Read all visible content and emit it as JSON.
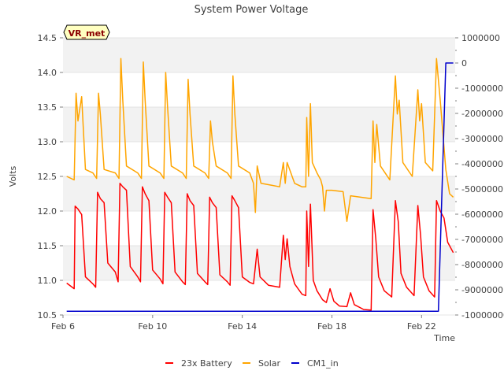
{
  "chart_data": {
    "type": "line",
    "title": "System Power Voltage",
    "xlabel": "Time",
    "ylabel": "Volts",
    "badge": "VR_met",
    "x_axis": {
      "type": "date",
      "start": "2024-02-06T00:00",
      "end": "2024-02-23T12:00",
      "ticks": [
        "Feb 6",
        "Feb 10",
        "Feb 14",
        "Feb 18",
        "Feb 22"
      ],
      "tick_dates": [
        "2024-02-06",
        "2024-02-10",
        "2024-02-14",
        "2024-02-18",
        "2024-02-22"
      ]
    },
    "y_axis_left": {
      "range": [
        10.5,
        14.5
      ],
      "ticks": [
        "10.5",
        "11.0",
        "11.5",
        "12.0",
        "12.5",
        "13.0",
        "13.5",
        "14.0",
        "14.5"
      ],
      "grid": true,
      "bands": "alternating gray"
    },
    "y_axis_right": {
      "range": [
        -10000000,
        1000000
      ],
      "ticks": [
        "-10000000",
        "-9000000",
        "-8000000",
        "-7000000",
        "-6000000",
        "-5000000",
        "-4000000",
        "-3000000",
        "-2000000",
        "-1000000",
        "0",
        "1000000"
      ]
    },
    "legend": {
      "placement": "bottom-center",
      "entries": [
        "23x Battery",
        "Solar",
        "CM1_in"
      ]
    },
    "series": [
      {
        "name": "23x Battery",
        "axis": "left",
        "color": "#ff0000",
        "points": [
          [
            "2024-02-06T04:00",
            10.96
          ],
          [
            "2024-02-06T12:00",
            10.88
          ],
          [
            "2024-02-06T13:00",
            12.07
          ],
          [
            "2024-02-06T16:00",
            12.03
          ],
          [
            "2024-02-06T20:00",
            11.95
          ],
          [
            "2024-02-07T00:00",
            11.05
          ],
          [
            "2024-02-07T08:00",
            10.95
          ],
          [
            "2024-02-07T11:00",
            10.9
          ],
          [
            "2024-02-07T13:00",
            12.27
          ],
          [
            "2024-02-07T16:00",
            12.18
          ],
          [
            "2024-02-07T20:00",
            12.12
          ],
          [
            "2024-02-08T00:00",
            11.25
          ],
          [
            "2024-02-08T08:00",
            11.12
          ],
          [
            "2024-02-08T11:00",
            10.98
          ],
          [
            "2024-02-08T13:00",
            12.4
          ],
          [
            "2024-02-08T16:00",
            12.35
          ],
          [
            "2024-02-08T20:00",
            12.3
          ],
          [
            "2024-02-09T00:00",
            11.2
          ],
          [
            "2024-02-09T08:00",
            11.05
          ],
          [
            "2024-02-09T11:00",
            10.98
          ],
          [
            "2024-02-09T13:00",
            12.35
          ],
          [
            "2024-02-09T16:00",
            12.25
          ],
          [
            "2024-02-09T20:00",
            12.15
          ],
          [
            "2024-02-10T00:00",
            11.15
          ],
          [
            "2024-02-10T08:00",
            11.02
          ],
          [
            "2024-02-10T11:00",
            10.95
          ],
          [
            "2024-02-10T13:00",
            12.27
          ],
          [
            "2024-02-10T16:00",
            12.2
          ],
          [
            "2024-02-10T20:00",
            12.12
          ],
          [
            "2024-02-11T00:00",
            11.12
          ],
          [
            "2024-02-11T08:00",
            10.98
          ],
          [
            "2024-02-11T11:00",
            10.94
          ],
          [
            "2024-02-11T13:00",
            12.25
          ],
          [
            "2024-02-11T16:00",
            12.15
          ],
          [
            "2024-02-11T20:00",
            12.08
          ],
          [
            "2024-02-12T00:00",
            11.1
          ],
          [
            "2024-02-12T08:00",
            10.98
          ],
          [
            "2024-02-12T11:00",
            10.94
          ],
          [
            "2024-02-12T13:00",
            12.2
          ],
          [
            "2024-02-12T16:00",
            12.12
          ],
          [
            "2024-02-12T20:00",
            12.05
          ],
          [
            "2024-02-13T00:00",
            11.08
          ],
          [
            "2024-02-13T08:00",
            10.98
          ],
          [
            "2024-02-13T11:00",
            10.93
          ],
          [
            "2024-02-13T13:00",
            12.22
          ],
          [
            "2024-02-13T16:00",
            12.15
          ],
          [
            "2024-02-13T20:00",
            12.05
          ],
          [
            "2024-02-14T00:00",
            11.05
          ],
          [
            "2024-02-14T08:00",
            10.97
          ],
          [
            "2024-02-14T12:00",
            10.95
          ],
          [
            "2024-02-14T14:00",
            11.2
          ],
          [
            "2024-02-14T16:00",
            11.45
          ],
          [
            "2024-02-14T19:00",
            11.05
          ],
          [
            "2024-02-15T04:00",
            10.93
          ],
          [
            "2024-02-15T16:00",
            10.9
          ],
          [
            "2024-02-15T20:00",
            11.65
          ],
          [
            "2024-02-15T22:00",
            11.3
          ],
          [
            "2024-02-16T00:00",
            11.6
          ],
          [
            "2024-02-16T03:00",
            11.2
          ],
          [
            "2024-02-16T08:00",
            10.95
          ],
          [
            "2024-02-16T16:00",
            10.8
          ],
          [
            "2024-02-16T20:00",
            10.78
          ],
          [
            "2024-02-16T21:00",
            12.0
          ],
          [
            "2024-02-16T23:00",
            11.2
          ],
          [
            "2024-02-17T01:00",
            12.1
          ],
          [
            "2024-02-17T04:00",
            11.0
          ],
          [
            "2024-02-17T08:00",
            10.85
          ],
          [
            "2024-02-17T14:00",
            10.72
          ],
          [
            "2024-02-17T18:00",
            10.68
          ],
          [
            "2024-02-17T22:00",
            10.88
          ],
          [
            "2024-02-18T02:00",
            10.7
          ],
          [
            "2024-02-18T08:00",
            10.63
          ],
          [
            "2024-02-18T16:00",
            10.62
          ],
          [
            "2024-02-18T20:00",
            10.82
          ],
          [
            "2024-02-19T00:00",
            10.65
          ],
          [
            "2024-02-19T10:00",
            10.58
          ],
          [
            "2024-02-19T18:00",
            10.57
          ],
          [
            "2024-02-19T20:00",
            12.02
          ],
          [
            "2024-02-19T23:00",
            11.6
          ],
          [
            "2024-02-20T02:00",
            11.05
          ],
          [
            "2024-02-20T08:00",
            10.85
          ],
          [
            "2024-02-20T16:00",
            10.76
          ],
          [
            "2024-02-20T20:00",
            12.15
          ],
          [
            "2024-02-20T23:00",
            11.85
          ],
          [
            "2024-02-21T02:00",
            11.1
          ],
          [
            "2024-02-21T08:00",
            10.9
          ],
          [
            "2024-02-21T16:00",
            10.78
          ],
          [
            "2024-02-21T20:00",
            12.08
          ],
          [
            "2024-02-21T23:00",
            11.65
          ],
          [
            "2024-02-22T02:00",
            11.05
          ],
          [
            "2024-02-22T08:00",
            10.85
          ],
          [
            "2024-02-22T14:00",
            10.76
          ],
          [
            "2024-02-22T16:00",
            12.15
          ],
          [
            "2024-02-22T20:00",
            12.0
          ],
          [
            "2024-02-23T00:00",
            11.9
          ],
          [
            "2024-02-23T04:00",
            11.55
          ],
          [
            "2024-02-23T10:00",
            11.4
          ]
        ]
      },
      {
        "name": "Solar",
        "axis": "left",
        "color": "#ffa500",
        "points": [
          [
            "2024-02-06T04:00",
            12.5
          ],
          [
            "2024-02-06T12:00",
            12.45
          ],
          [
            "2024-02-06T14:00",
            13.7
          ],
          [
            "2024-02-06T16:00",
            13.3
          ],
          [
            "2024-02-06T20:00",
            13.65
          ],
          [
            "2024-02-07T00:00",
            12.6
          ],
          [
            "2024-02-07T08:00",
            12.55
          ],
          [
            "2024-02-07T12:00",
            12.47
          ],
          [
            "2024-02-07T14:00",
            13.7
          ],
          [
            "2024-02-07T16:00",
            13.4
          ],
          [
            "2024-02-07T20:00",
            12.6
          ],
          [
            "2024-02-08T08:00",
            12.55
          ],
          [
            "2024-02-08T12:00",
            12.47
          ],
          [
            "2024-02-08T14:00",
            14.2
          ],
          [
            "2024-02-08T16:00",
            13.6
          ],
          [
            "2024-02-08T20:00",
            12.65
          ],
          [
            "2024-02-09T08:00",
            12.55
          ],
          [
            "2024-02-09T12:00",
            12.47
          ],
          [
            "2024-02-09T14:00",
            14.15
          ],
          [
            "2024-02-09T16:00",
            13.6
          ],
          [
            "2024-02-09T20:00",
            12.65
          ],
          [
            "2024-02-10T08:00",
            12.55
          ],
          [
            "2024-02-10T12:00",
            12.47
          ],
          [
            "2024-02-10T14:00",
            14.0
          ],
          [
            "2024-02-10T16:00",
            13.5
          ],
          [
            "2024-02-10T20:00",
            12.65
          ],
          [
            "2024-02-11T08:00",
            12.55
          ],
          [
            "2024-02-11T12:00",
            12.47
          ],
          [
            "2024-02-11T14:00",
            13.9
          ],
          [
            "2024-02-11T16:00",
            13.4
          ],
          [
            "2024-02-11T20:00",
            12.65
          ],
          [
            "2024-02-12T08:00",
            12.55
          ],
          [
            "2024-02-12T12:00",
            12.47
          ],
          [
            "2024-02-12T14:00",
            13.3
          ],
          [
            "2024-02-12T16:00",
            13.0
          ],
          [
            "2024-02-12T20:00",
            12.65
          ],
          [
            "2024-02-13T08:00",
            12.55
          ],
          [
            "2024-02-13T12:00",
            12.47
          ],
          [
            "2024-02-13T14:00",
            13.95
          ],
          [
            "2024-02-13T16:00",
            13.4
          ],
          [
            "2024-02-13T20:00",
            12.65
          ],
          [
            "2024-02-14T08:00",
            12.55
          ],
          [
            "2024-02-14T12:00",
            12.4
          ],
          [
            "2024-02-14T14:00",
            11.98
          ],
          [
            "2024-02-14T16:00",
            12.65
          ],
          [
            "2024-02-14T20:00",
            12.4
          ],
          [
            "2024-02-15T08:00",
            12.37
          ],
          [
            "2024-02-15T16:00",
            12.35
          ],
          [
            "2024-02-15T20:00",
            12.7
          ],
          [
            "2024-02-15T22:00",
            12.4
          ],
          [
            "2024-02-16T00:00",
            12.7
          ],
          [
            "2024-02-16T08:00",
            12.4
          ],
          [
            "2024-02-16T16:00",
            12.35
          ],
          [
            "2024-02-16T20:00",
            12.35
          ],
          [
            "2024-02-16T21:00",
            13.35
          ],
          [
            "2024-02-16T23:00",
            12.5
          ],
          [
            "2024-02-17T01:00",
            13.55
          ],
          [
            "2024-02-17T03:00",
            12.7
          ],
          [
            "2024-02-17T08:00",
            12.55
          ],
          [
            "2024-02-17T12:00",
            12.45
          ],
          [
            "2024-02-17T14:00",
            12.35
          ],
          [
            "2024-02-17T16:00",
            12.0
          ],
          [
            "2024-02-17T18:00",
            12.3
          ],
          [
            "2024-02-18T00:00",
            12.3
          ],
          [
            "2024-02-18T12:00",
            12.28
          ],
          [
            "2024-02-18T16:00",
            11.85
          ],
          [
            "2024-02-18T20:00",
            12.22
          ],
          [
            "2024-02-19T18:00",
            12.18
          ],
          [
            "2024-02-19T20:00",
            13.3
          ],
          [
            "2024-02-19T22:00",
            12.7
          ],
          [
            "2024-02-20T00:00",
            13.25
          ],
          [
            "2024-02-20T04:00",
            12.65
          ],
          [
            "2024-02-20T14:00",
            12.45
          ],
          [
            "2024-02-20T20:00",
            13.95
          ],
          [
            "2024-02-20T22:00",
            13.4
          ],
          [
            "2024-02-21T00:00",
            13.6
          ],
          [
            "2024-02-21T04:00",
            12.7
          ],
          [
            "2024-02-21T14:00",
            12.5
          ],
          [
            "2024-02-21T20:00",
            13.75
          ],
          [
            "2024-02-21T22:00",
            13.3
          ],
          [
            "2024-02-22T00:00",
            13.55
          ],
          [
            "2024-02-22T04:00",
            12.7
          ],
          [
            "2024-02-22T12:00",
            12.58
          ],
          [
            "2024-02-22T16:00",
            14.2
          ],
          [
            "2024-02-22T20:00",
            13.6
          ],
          [
            "2024-02-23T02:00",
            12.6
          ],
          [
            "2024-02-23T06:00",
            12.25
          ],
          [
            "2024-02-23T10:00",
            12.2
          ]
        ]
      },
      {
        "name": "CM1_in",
        "axis": "right",
        "color": "#0000cc",
        "points": [
          [
            "2024-02-06T04:00",
            -9850000
          ],
          [
            "2024-02-22T18:00",
            -9850000
          ],
          [
            "2024-02-23T02:00",
            0
          ],
          [
            "2024-02-23T10:00",
            0
          ]
        ]
      }
    ]
  }
}
